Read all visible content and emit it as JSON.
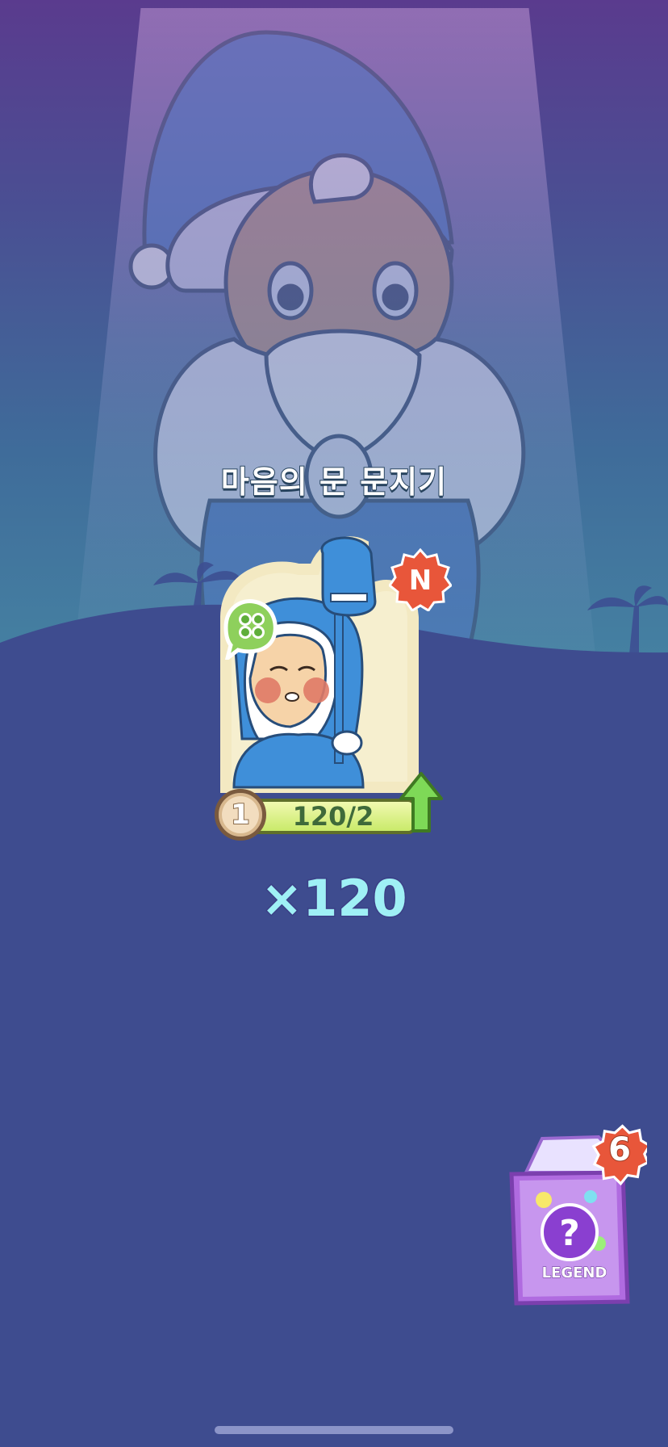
{
  "character": {
    "title": "마음의 문 문지기",
    "rarity_badge": "N",
    "level": "1",
    "count_progress": "120/2",
    "quantity": "×120"
  },
  "pack": {
    "label": "LEGEND",
    "count": "6",
    "symbol": "?"
  },
  "colors": {
    "background": "#3e4c8f",
    "quantity_text": "#9ff0f5",
    "rarity_badge": "#e8563a",
    "upgrade_arrow": "#7ed957",
    "pack_purple": "#b06be0"
  },
  "icons": {
    "clover": "clover-icon",
    "upgrade": "arrow-up-icon"
  }
}
